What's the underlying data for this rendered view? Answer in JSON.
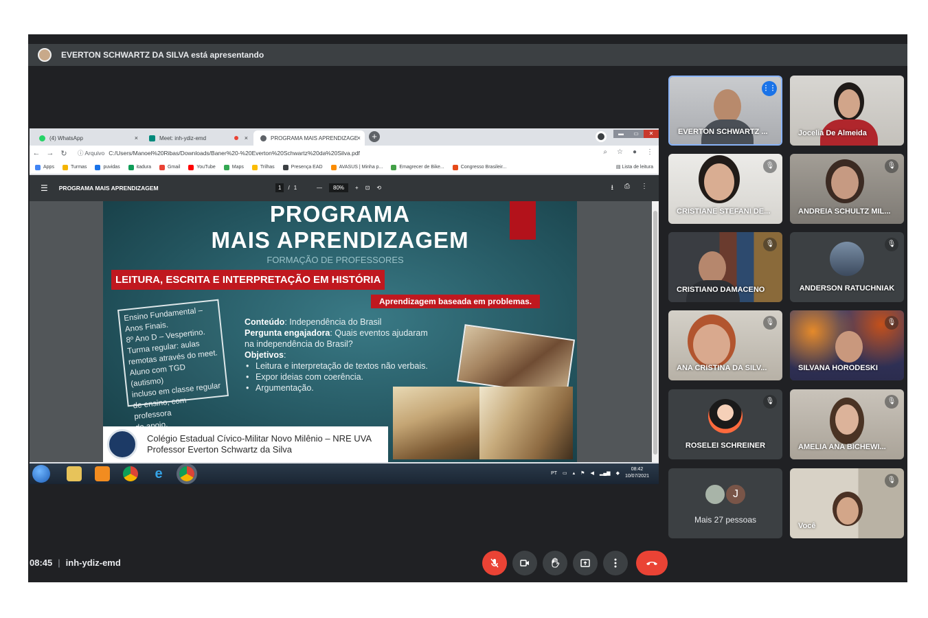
{
  "presenter_banner": "EVERTON SCHWARTZ DA SILVA está apresentando",
  "browser": {
    "tabs": [
      {
        "label": "(4) WhatsApp",
        "close": "×"
      },
      {
        "label": "Meet: inh-ydiz-emd",
        "close": "×"
      },
      {
        "label": "PROGRAMA MAIS APRENDIZAGE",
        "close": "×"
      }
    ],
    "newtab": "+",
    "window_controls": {
      "min": "▬",
      "max": "▭",
      "close": "✕"
    },
    "address": {
      "info": "ⓘ Arquivo",
      "url": "C:/Users/Manoel%20Ribas/Downloads/Baner%20-%20Everton%20Schwartz%20da%20Silva.pdf"
    },
    "bookmarks": [
      "Apps",
      "Turmas",
      "puvidas",
      "itadura",
      "Gmail",
      "YouTube",
      "Maps",
      "Trilhas",
      "Presença EAD",
      "AVASUS | Minha p...",
      "Emagrecer de Bike...",
      "Congresso Brasileir..."
    ],
    "reading_list": "Lista de leitura"
  },
  "pdf": {
    "title": "PROGRAMA MAIS APRENDIZAGEM",
    "page_current": "1",
    "page_sep": "/",
    "page_total": "1",
    "zoom_minus": "—",
    "zoom": "80%",
    "zoom_plus": "+"
  },
  "slide": {
    "title_line1": "PROGRAMA",
    "title_line2": "MAIS APRENDIZAGEM",
    "subtitle": "FORMAÇÃO DE PROFESSORES",
    "red_label": "LEITURA, ESCRITA E INTERPRETAÇÃO EM HISTÓRIA",
    "problem_label": "Aprendizagem baseada em problemas.",
    "note_lines": [
      "Ensino Fundamental –",
      "Anos Finais.",
      "8º Ano D – Vespertino.",
      "Turma regular: aulas",
      "remotas através do meet.",
      "Aluno com TGD (autismo)",
      "incluso em classe regular",
      "de ensino, com professora",
      "de apoio."
    ],
    "content_label": "Conteúdo",
    "content_text": ": Independência do Brasil",
    "question_label": "Pergunta engajadora",
    "question_text": ": Quais eventos ajudaram na independência do Brasil?",
    "objectives_label": "Objetivos",
    "objectives_colon": ":",
    "objectives": [
      "Leitura e interpretação de textos não verbais.",
      "Expor ideias com coerência.",
      "Argumentação."
    ],
    "footer_line1": "Colégio Estadual Cívico-Militar Novo Milênio – NRE UVA",
    "footer_line2": "Professor Everton Schwartz da Silva"
  },
  "taskbar": {
    "ie_glyph": "e",
    "lang": "PT",
    "time": "08:42",
    "date": "10/07/2021"
  },
  "participants": [
    {
      "name": "EVERTON SCHWARTZ ...",
      "state": "speaking"
    },
    {
      "name": "Jocelia De Almeida",
      "state": "none"
    },
    {
      "name": "CRISTIANE STEFANI DE...",
      "state": "muted"
    },
    {
      "name": "ANDREIA SCHULTZ MIL...",
      "state": "muted"
    },
    {
      "name": "CRISTIANO DAMACENO",
      "state": "muted"
    },
    {
      "name": "ANDERSON RATUCHNIAK",
      "state": "muted"
    },
    {
      "name": "ANA CRISTINA DA SILV...",
      "state": "muted"
    },
    {
      "name": "SILVANA HORODESKI",
      "state": "muted"
    },
    {
      "name": "ROSELEI SCHREINER",
      "state": "muted"
    },
    {
      "name": "AMELIA ANA BICHEWI...",
      "state": "muted"
    },
    {
      "name": "Você",
      "state": "muted"
    }
  ],
  "more_people": {
    "initial": "J",
    "label": "Mais 27 pessoas"
  },
  "meeting": {
    "time": "08:45",
    "separator": "|",
    "code": "inh-ydiz-emd"
  },
  "icons": {
    "muted": "mic-off-icon",
    "speaking": "audio-level-icon"
  },
  "colors": {
    "background": "#202124",
    "tile": "#3c4043",
    "hangup": "#ea4335",
    "active_border": "#8ab4f8",
    "slide_red": "#c0181f"
  }
}
